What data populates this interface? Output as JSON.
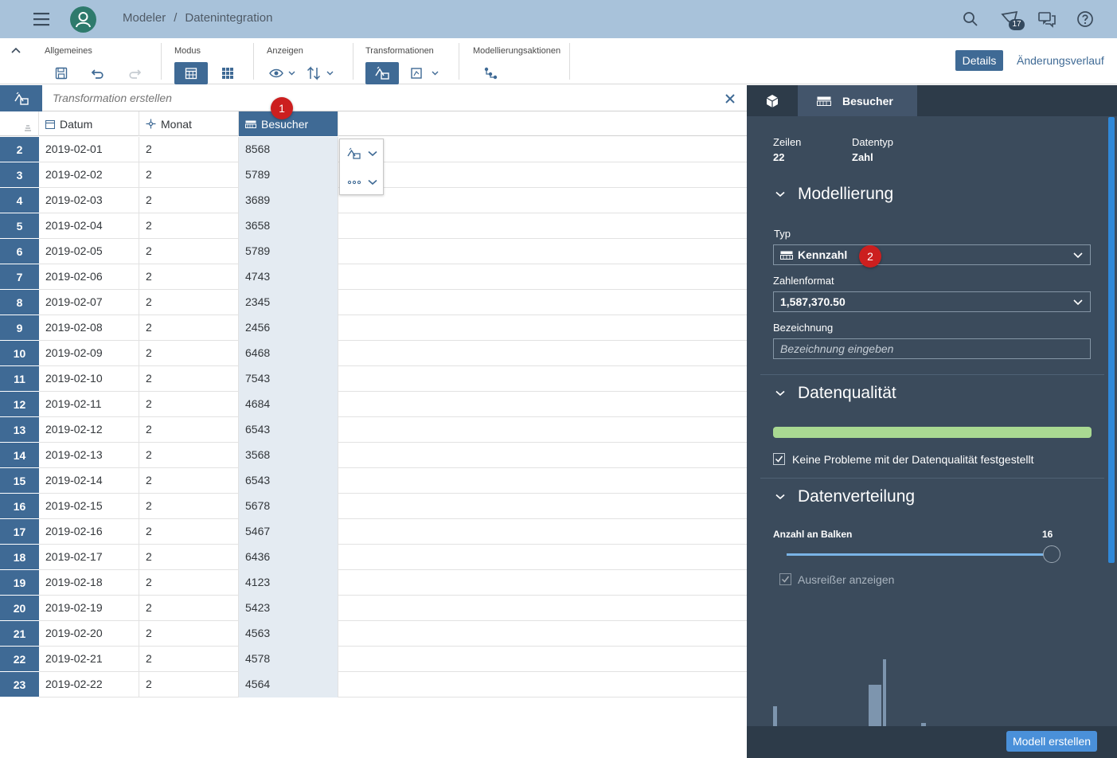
{
  "shell": {
    "breadcrumb": [
      "Modeler",
      "Datenintegration"
    ],
    "breadcrumb_sep": "/",
    "notification_count": "17",
    "icons": [
      "hamburger-icon",
      "user-icon",
      "search-icon",
      "notification-icon",
      "chat-icon",
      "help-icon"
    ]
  },
  "toolbar": {
    "groups": {
      "general": "Allgemeines",
      "mode": "Modus",
      "view": "Anzeigen",
      "transform": "Transformationen",
      "modeling": "Modellierungsaktionen"
    },
    "details_label": "Details",
    "history_label": "Änderungsverlauf"
  },
  "transform_bar": {
    "placeholder": "Transformation erstellen"
  },
  "table": {
    "columns": [
      {
        "label": "Datum",
        "icon": "calendar-icon"
      },
      {
        "label": "Monat",
        "icon": "dimension-icon"
      },
      {
        "label": "Besucher",
        "icon": "measure-icon"
      }
    ],
    "rows": [
      {
        "n": "2",
        "datum": "2019-02-01",
        "monat": "2",
        "besucher": "8568"
      },
      {
        "n": "3",
        "datum": "2019-02-02",
        "monat": "2",
        "besucher": "5789"
      },
      {
        "n": "4",
        "datum": "2019-02-03",
        "monat": "2",
        "besucher": "3689"
      },
      {
        "n": "5",
        "datum": "2019-02-04",
        "monat": "2",
        "besucher": "3658"
      },
      {
        "n": "6",
        "datum": "2019-02-05",
        "monat": "2",
        "besucher": "5789"
      },
      {
        "n": "7",
        "datum": "2019-02-06",
        "monat": "2",
        "besucher": "4743"
      },
      {
        "n": "8",
        "datum": "2019-02-07",
        "monat": "2",
        "besucher": "2345"
      },
      {
        "n": "9",
        "datum": "2019-02-08",
        "monat": "2",
        "besucher": "2456"
      },
      {
        "n": "10",
        "datum": "2019-02-09",
        "monat": "2",
        "besucher": "6468"
      },
      {
        "n": "11",
        "datum": "2019-02-10",
        "monat": "2",
        "besucher": "7543"
      },
      {
        "n": "12",
        "datum": "2019-02-11",
        "monat": "2",
        "besucher": "4684"
      },
      {
        "n": "13",
        "datum": "2019-02-12",
        "monat": "2",
        "besucher": "6543"
      },
      {
        "n": "14",
        "datum": "2019-02-13",
        "monat": "2",
        "besucher": "3568"
      },
      {
        "n": "15",
        "datum": "2019-02-14",
        "monat": "2",
        "besucher": "6543"
      },
      {
        "n": "16",
        "datum": "2019-02-15",
        "monat": "2",
        "besucher": "5678"
      },
      {
        "n": "17",
        "datum": "2019-02-16",
        "monat": "2",
        "besucher": "5467"
      },
      {
        "n": "18",
        "datum": "2019-02-17",
        "monat": "2",
        "besucher": "6436"
      },
      {
        "n": "19",
        "datum": "2019-02-18",
        "monat": "2",
        "besucher": "4123"
      },
      {
        "n": "20",
        "datum": "2019-02-19",
        "monat": "2",
        "besucher": "5423"
      },
      {
        "n": "21",
        "datum": "2019-02-20",
        "monat": "2",
        "besucher": "4563"
      },
      {
        "n": "22",
        "datum": "2019-02-21",
        "monat": "2",
        "besucher": "4578"
      },
      {
        "n": "23",
        "datum": "2019-02-22",
        "monat": "2",
        "besucher": "4564"
      }
    ]
  },
  "markers": {
    "one": "1",
    "two": "2"
  },
  "panel": {
    "tab_label": "Besucher",
    "rows_label": "Zeilen",
    "rows_value": "22",
    "datatype_label": "Datentyp",
    "datatype_value": "Zahl",
    "modeling": {
      "title": "Modellierung",
      "type_label": "Typ",
      "type_value": "Kennzahl",
      "format_label": "Zahlenformat",
      "format_value": "1,587,370.50",
      "desc_label": "Bezeichnung",
      "desc_placeholder": "Bezeichnung eingeben"
    },
    "quality": {
      "title": "Datenqualität",
      "fraction_ok": 1.0,
      "message": "Keine Probleme mit der Datenqualität festgestellt"
    },
    "distribution": {
      "title": "Datenverteilung",
      "bins_label": "Anzahl an Balken",
      "bins_value": "16",
      "outliers_label": "Ausreißer anzeigen"
    },
    "create_button": "Modell erstellen"
  },
  "colors": {
    "shell": "#a8c2da",
    "accent": "#3f6a95",
    "panel": "#3b4b5c",
    "quality_ok": "#a9d992",
    "marker": "#cc1f1f"
  }
}
